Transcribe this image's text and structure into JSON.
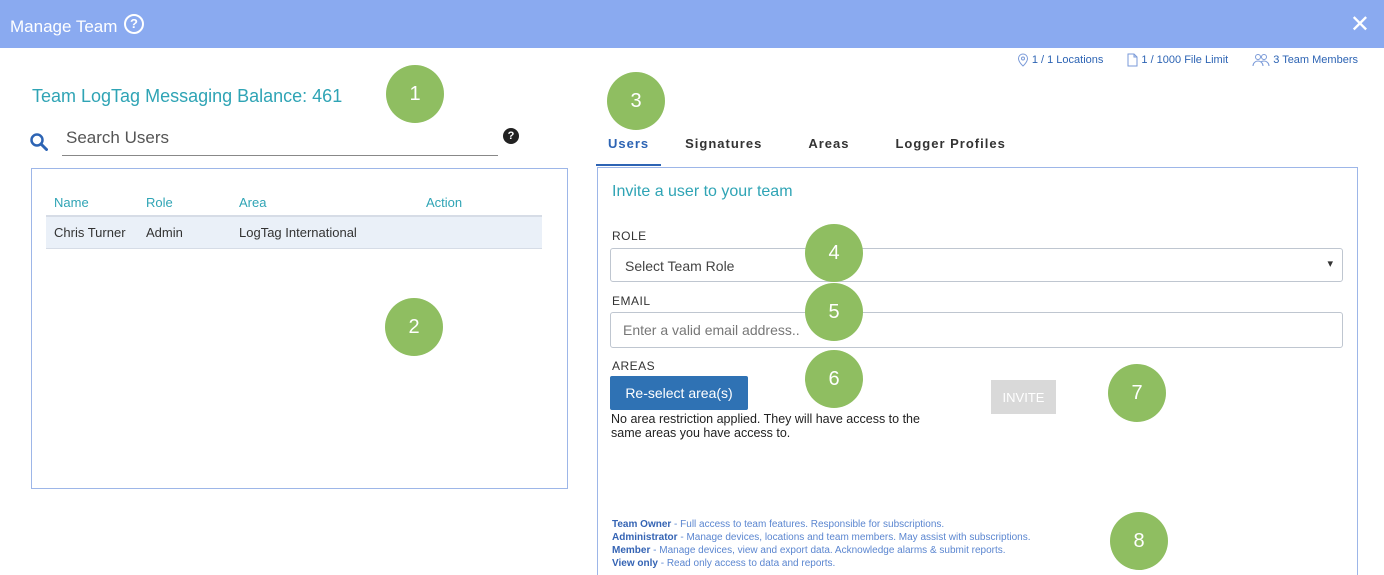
{
  "window": {
    "title": "Manage Team",
    "close_symbol": "✕",
    "help_symbol": "?"
  },
  "stats": {
    "locations": "1 / 1 Locations",
    "file_limit": "1 / 1000 File Limit",
    "team_members": "3 Team Members"
  },
  "balance": "Team LogTag Messaging Balance: 461",
  "search": {
    "placeholder": "Search Users",
    "help_symbol": "?"
  },
  "users_table": {
    "columns": [
      "Name",
      "Role",
      "Area",
      "Action"
    ],
    "rows": [
      {
        "name": "Chris Turner",
        "role": "Admin",
        "area": "LogTag International",
        "action": ""
      }
    ]
  },
  "tabs": [
    "Users",
    "Signatures",
    "Areas",
    "Logger Profiles"
  ],
  "invite": {
    "title": "Invite a user to your team",
    "role_label": "ROLE",
    "role_value": "Select Team Role",
    "email_label": "EMAIL",
    "email_placeholder": "Enter a valid email address..",
    "areas_label": "AREAS",
    "reselect_label": "Re-select area(s)",
    "area_note": "No area restriction applied. They will have access to the same areas you have access to.",
    "invite_label": "INVITE"
  },
  "roles": [
    {
      "name": "Team Owner",
      "desc": " - Full access to team features. Responsible for subscriptions."
    },
    {
      "name": "Administrator",
      "desc": " - Manage devices, locations and team members. May assist with subscriptions."
    },
    {
      "name": "Member",
      "desc": " - Manage devices, view and export data. Acknowledge alarms & submit reports."
    },
    {
      "name": "View only",
      "desc": " - Read only access to data and reports."
    }
  ],
  "markers": [
    "1",
    "2",
    "3",
    "4",
    "5",
    "6",
    "7",
    "8"
  ],
  "colors": {
    "titlebar": "#8aaaf0",
    "accent_teal": "#2fa4b5",
    "link_blue": "#2d64b4",
    "button_blue": "#2f72b4",
    "marker_green": "#8fbe61"
  }
}
